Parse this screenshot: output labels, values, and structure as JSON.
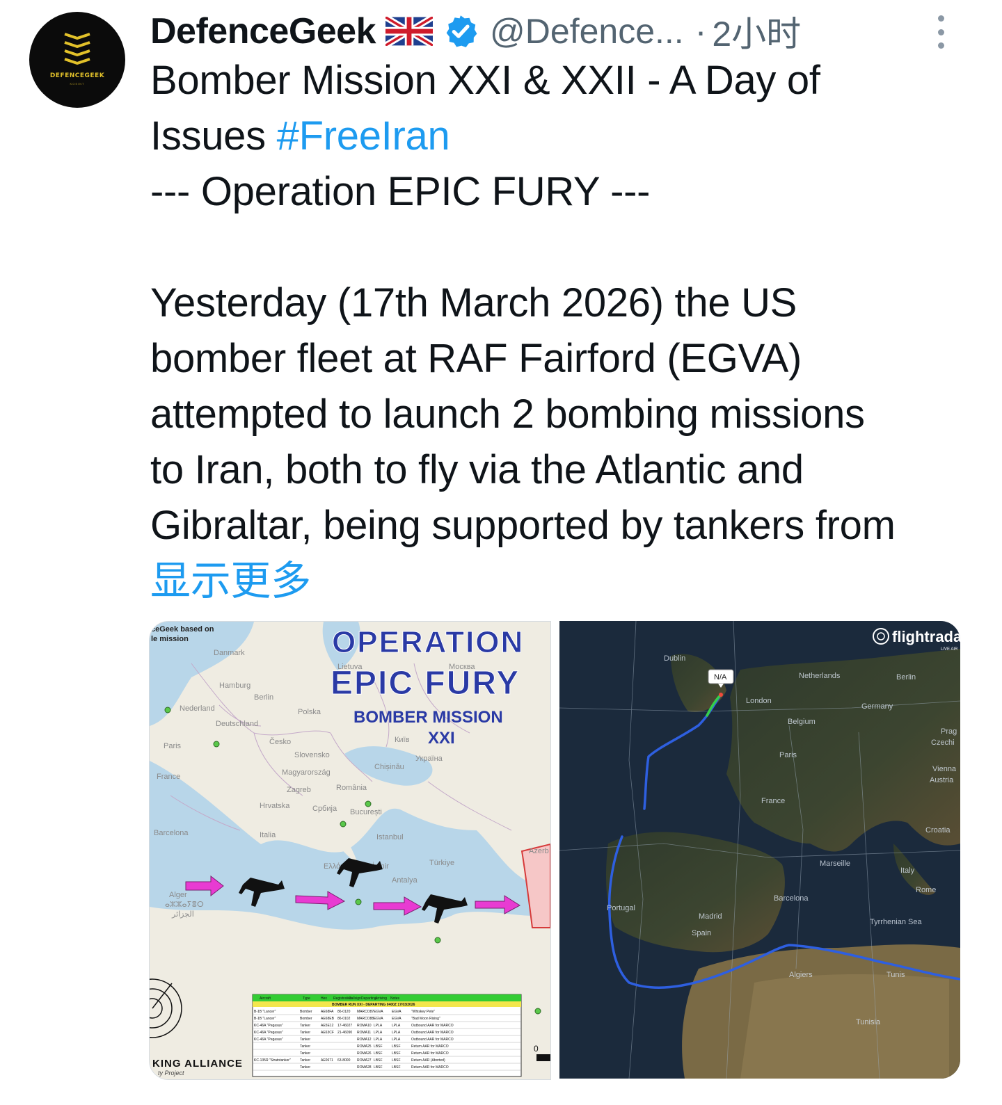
{
  "author": {
    "avatar_wordmark": "DEFENCEGEEK",
    "avatar_sub": "KOSINT",
    "display_name": "DefenceGeek",
    "flag_icon": "uk-flag-icon",
    "verified_icon": "verified-badge-icon",
    "handle": "@Defence...",
    "separator": "·",
    "timestamp": "2小时"
  },
  "more_menu_icon": "more-vertical-icon",
  "tweet": {
    "line1": "Bomber Mission XXI & XXII - A Day of",
    "line2_text": "Issues ",
    "hashtag": "#FreeIran",
    "line3": "--- Operation EPIC FURY ---",
    "line4": "Yesterday (17th March 2026) the US",
    "line5": "bomber fleet at RAF Fairford (EGVA)",
    "line6": "attempted to launch 2 bombing missions",
    "line7": "to Iran, both to fly via the Atlantic and",
    "line8": "Gibraltar, being supported by tankers from",
    "show_more": "显示更多"
  },
  "media_left": {
    "corner_note_1": "ceGeek based on",
    "corner_note_2": "le mission",
    "title_1": "OPERATION",
    "title_2": "EPIC FURY",
    "subtitle_1": "BOMBER MISSION",
    "subtitle_2": "XXI",
    "bottom_brand": "KING ALLIANCE",
    "bottom_sub": "ty Project",
    "map_labels": [
      "Danmark",
      "Hamburg",
      "Berlin",
      "Nederland",
      "Deutschland",
      "Polska",
      "Lietuva",
      "Москва",
      "Česko",
      "Slovensko",
      "Paris",
      "France",
      "Magyarország",
      "Zagreb",
      "Hrvatska",
      "România",
      "Chișinău",
      "Україна",
      "Србија",
      "București",
      "Barcelona",
      "Italia",
      "Istanbul",
      "Türkiye",
      "Ελλάς",
      "İzmir",
      "Antalya",
      "Alger",
      "ⴰⵣⵣⴰⵢⴻⵔ",
      "الجزائر",
      "Azerb",
      "Київ"
    ],
    "table_header": [
      "Aircraft",
      "Type",
      "Hex",
      "Registration",
      "Callsign",
      "Departing",
      "Arriving",
      "Notes"
    ],
    "table_banner": "BOMBER RUN XXI - DEPARTING 0400Z 17/03/2026",
    "table_rows": [
      [
        "B-1B \"Lancer\"",
        "Bomber",
        "AE68FA",
        "86-0120",
        "MARCO87",
        "EGVA",
        "EGVA",
        "\"Whiskey Pete\""
      ],
      [
        "B-1B \"Lancer\"",
        "Bomber",
        "AE68EB",
        "86-0102",
        "MARCO88",
        "EGVA",
        "EGVA",
        "\"Bad Moon Rising\""
      ],
      [
        "KC-46A \"Pegasus\"",
        "Tanker",
        "AE5E12",
        "17-46027",
        "ROMA10",
        "LPLA",
        "LPLA",
        "Outbound AAR for MARCO"
      ],
      [
        "KC-46A \"Pegasus\"",
        "Tanker",
        "AE63CF",
        "21-46090",
        "ROMA11",
        "LPLA",
        "LPLA",
        "Outbound AAR for MARCO"
      ],
      [
        "KC-46A \"Pegasus\"",
        "Tanker",
        "",
        "",
        "ROMA12",
        "LPLA",
        "LPLA",
        "Outbound AAR for MARCO"
      ],
      [
        "",
        "Tanker",
        "",
        "",
        "ROMA25",
        "LBSF",
        "LBSF",
        "Return AAR for MARCO"
      ],
      [
        "",
        "Tanker",
        "",
        "",
        "ROMA26",
        "LBSF",
        "LBSF",
        "Return AAR for MARCO"
      ],
      [
        "KC-135R \"Stratotanker\"",
        "Tanker",
        "AE0671",
        "63-8000",
        "ROMA27",
        "LBSF",
        "LBSF",
        "Return AAR (Aborted)"
      ],
      [
        "",
        "Tanker",
        "",
        "",
        "ROMA28",
        "LBSF",
        "LBSF",
        "Return AAR for MARCO"
      ]
    ],
    "edge_number": "0"
  },
  "media_right": {
    "brand": "flightrada",
    "brand_sub": "LIVE AIR",
    "callout": "N/A",
    "labels": [
      "Dublin",
      "Netherlands",
      "Berlin",
      "Germany",
      "London",
      "Belgium",
      "Prag",
      "Czechi",
      "Paris",
      "Vienna",
      "Austria",
      "France",
      "Croatia",
      "Marseille",
      "Italy",
      "Rome",
      "Portugal",
      "Barcelona",
      "Madrid",
      "Spain",
      "Tyrrhenian Sea",
      "Algiers",
      "Tunis",
      "Tunisia"
    ]
  },
  "colors": {
    "link": "#1d9bf0",
    "muted": "#536471",
    "verified": "#1d9bf0",
    "title_blue": "#2a3aa5",
    "arrow_pink": "#e83bd2",
    "table_green": "#33cc33"
  }
}
